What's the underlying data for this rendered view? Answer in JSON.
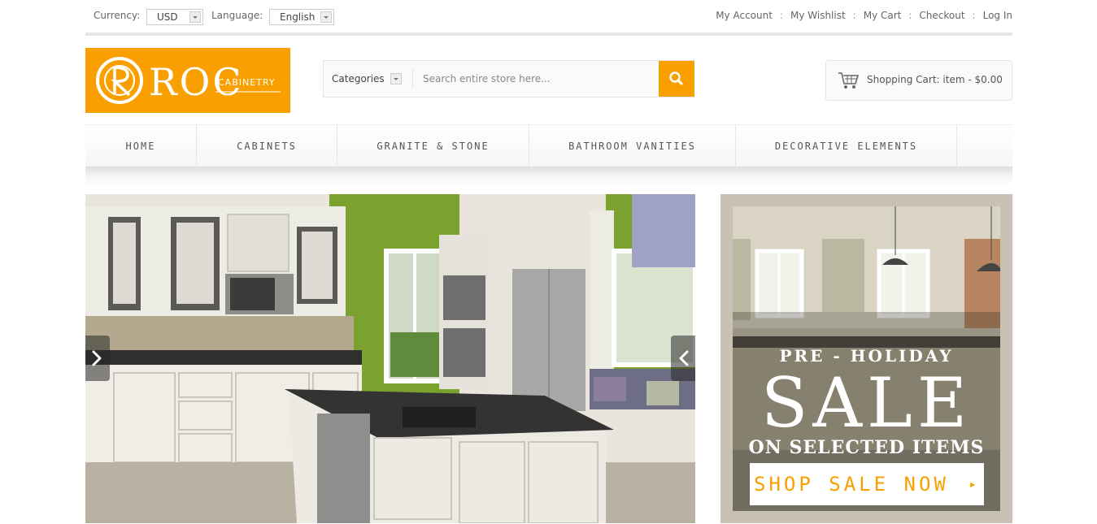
{
  "topbar": {
    "currency_label": "Currency:",
    "currency_value": "USD",
    "language_label": "Language:",
    "language_value": "English",
    "links": [
      "My Account",
      "My Wishlist",
      "My Cart",
      "Checkout",
      "Log In"
    ]
  },
  "header": {
    "logo_text": "ROC",
    "logo_subtext": "CABINETRY",
    "search": {
      "category_label": "Categories",
      "placeholder": "Search entire store here..."
    },
    "cart": {
      "label": "Shopping Cart:",
      "items": "item -",
      "total": "$0.00"
    }
  },
  "nav": {
    "items": [
      "HOME",
      "CABINETS",
      "GRANITE & STONE",
      "BATHROOM VANITIES",
      "DECORATIVE ELEMENTS"
    ]
  },
  "promo": {
    "pre": "PRE - HOLIDAY",
    "headline": "SALE",
    "sub": "ON SELECTED ITEMS",
    "button": "SHOP SALE NOW",
    "button_arrow": "▸"
  },
  "colors": {
    "accent": "#f9a000",
    "nav_text": "#555555",
    "kitchen_wall": "#7ba12e"
  },
  "icons": [
    "chevron-down-icon",
    "search-icon",
    "shopping-cart-icon",
    "chevron-right-icon",
    "chevron-left-icon"
  ]
}
